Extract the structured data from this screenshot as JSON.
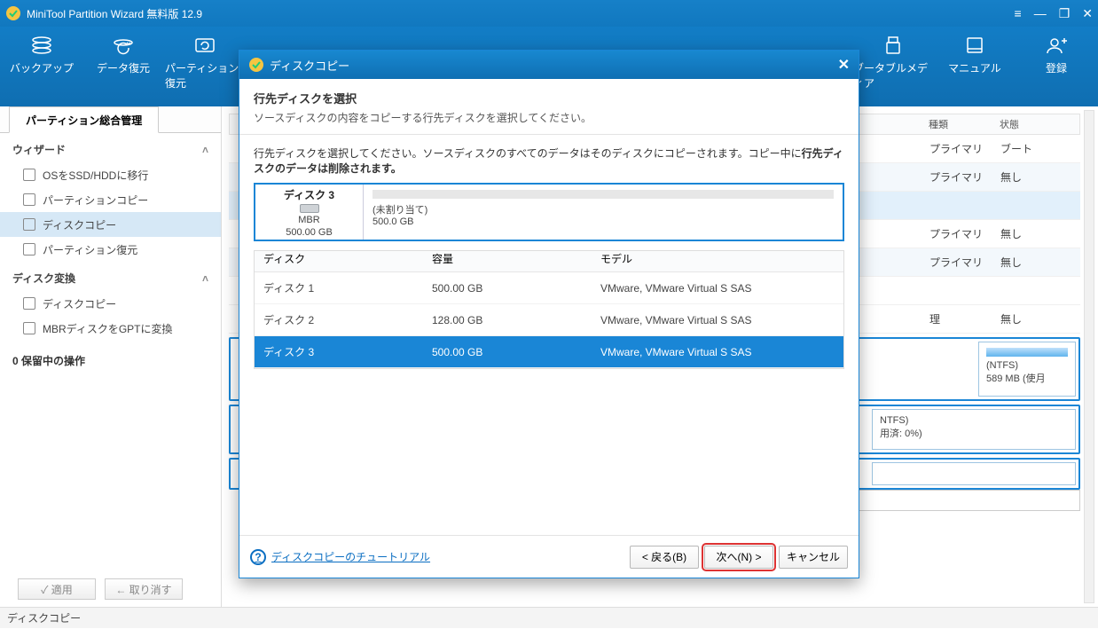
{
  "title": "MiniTool Partition Wizard 無料版 12.9",
  "toolbar": [
    {
      "name": "backup",
      "label": "バックアップ"
    },
    {
      "name": "recover",
      "label": "データ復元"
    },
    {
      "name": "partition-recover",
      "label": "パーティション復元"
    },
    {
      "name": "bootmedia",
      "label": "ブータブルメディア"
    },
    {
      "name": "manual",
      "label": "マニュアル"
    },
    {
      "name": "register",
      "label": "登録"
    }
  ],
  "tab": "パーティション総合管理",
  "sidebar": {
    "group1": {
      "title": "ウィザード",
      "items": [
        {
          "label": "OSをSSD/HDDに移行"
        },
        {
          "label": "パーティションコピー"
        },
        {
          "label": "ディスクコピー",
          "selected": true
        },
        {
          "label": "パーティション復元"
        }
      ]
    },
    "group2": {
      "title": "ディスク変換",
      "items": [
        {
          "label": "ディスクコピー"
        },
        {
          "label": "MBRディスクをGPTに変換"
        }
      ]
    },
    "pending": "0 保留中の操作",
    "apply": "✓ 適用",
    "undo": "← 取り消す"
  },
  "grid": {
    "headers": {
      "type": "種類",
      "status": "状態"
    },
    "rows": [
      {
        "type": "プライマリ",
        "status": "ブート"
      },
      {
        "type": "プライマリ",
        "status": "無し",
        "alt": true
      },
      {
        "type": "",
        "status": "",
        "sel": true
      },
      {
        "type": "プライマリ",
        "status": "無し"
      },
      {
        "type": "プライマリ",
        "status": "無し",
        "alt": true
      },
      {
        "type": "",
        "status": ""
      },
      {
        "type": "理",
        "status": "無し"
      }
    ],
    "diskbar": [
      {
        "fs": "(NTFS)",
        "sz": "589 MB (使月"
      }
    ],
    "diskbar2": [
      {
        "fs": "NTFS)",
        "sz": "用済: 0%)"
      }
    ],
    "smallbar": {
      "l": "500.00 GB",
      "r": "500.0 GB"
    }
  },
  "statusbar": "ディスクコピー",
  "modal": {
    "title": "ディスクコピー",
    "headTitle": "行先ディスクを選択",
    "headDesc": "ソースディスクの内容をコピーする行先ディスクを選択してください。",
    "prompt_a": "行先ディスクを選択してください。ソースディスクのすべてのデータはそのディスクにコピーされます。コピー中に",
    "prompt_b": "行先ディスクのデータは削除されます。",
    "card": {
      "name": "ディスク 3",
      "scheme": "MBR",
      "size": "500.00 GB",
      "unalloc": "(未割り当て)",
      "unallocSize": "500.0 GB"
    },
    "table": {
      "headers": {
        "disk": "ディスク",
        "cap": "容量",
        "model": "モデル"
      },
      "rows": [
        {
          "disk": "ディスク 1",
          "cap": "500.00 GB",
          "model": "VMware, VMware Virtual S SAS"
        },
        {
          "disk": "ディスク 2",
          "cap": "128.00 GB",
          "model": "VMware, VMware Virtual S SAS"
        },
        {
          "disk": "ディスク 3",
          "cap": "500.00 GB",
          "model": "VMware, VMware Virtual S SAS",
          "selected": true
        }
      ]
    },
    "help": "ディスクコピーのチュートリアル",
    "buttons": {
      "back": "< 戻る(B)",
      "next": "次へ(N) >",
      "cancel": "キャンセル"
    }
  }
}
